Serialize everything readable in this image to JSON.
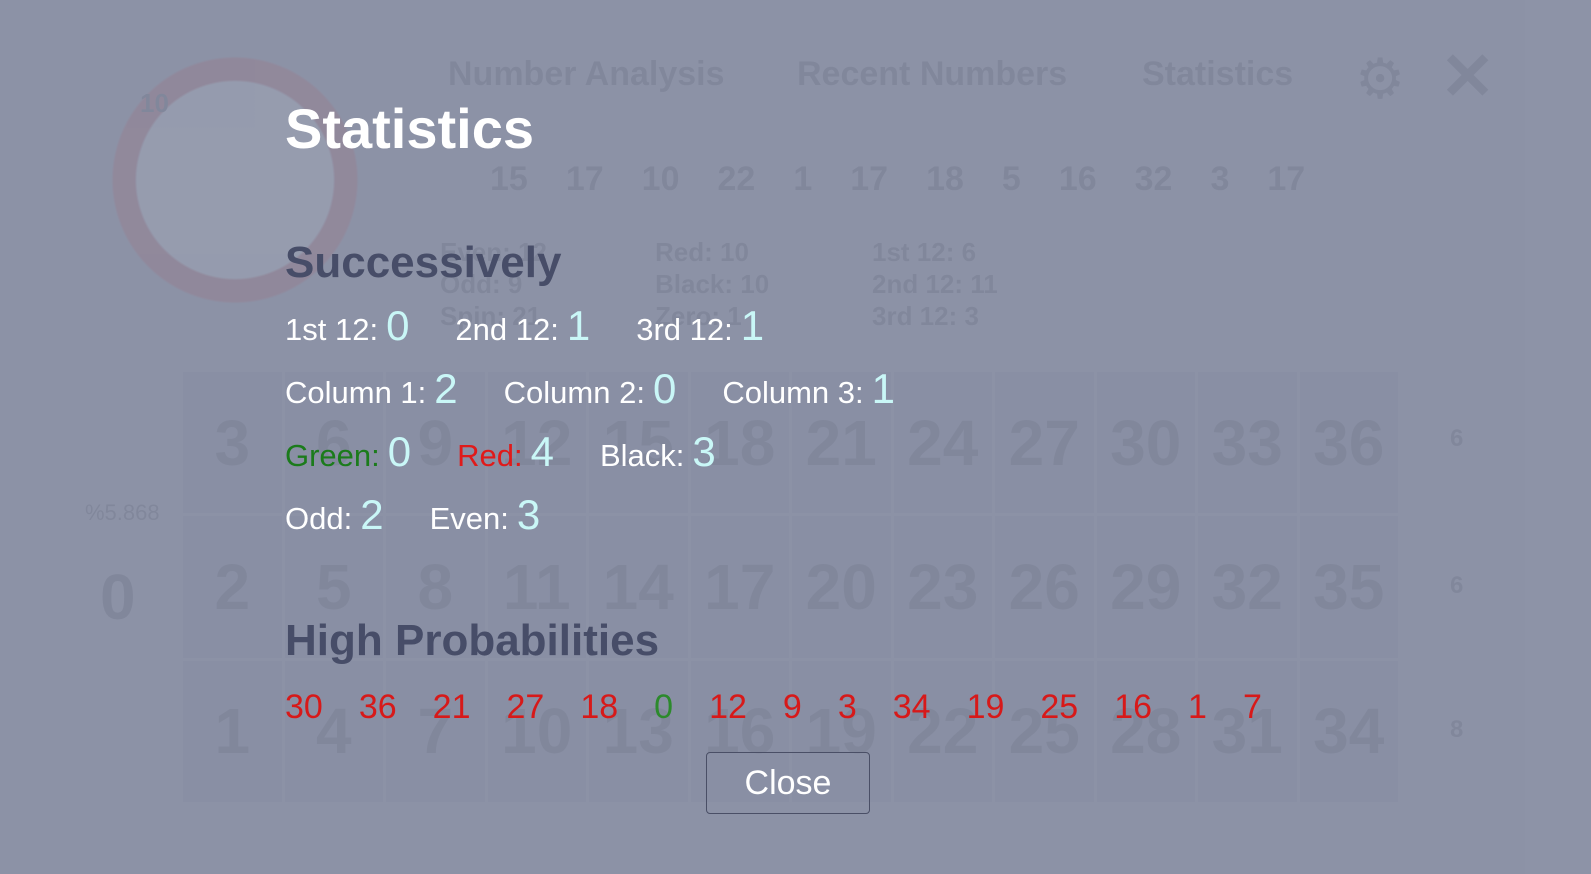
{
  "background": {
    "menu": [
      "Number Analysis",
      "Recent Numbers",
      "Statistics"
    ],
    "wheel_center": "10",
    "recent_numbers": [
      "15",
      "17",
      "10",
      "22",
      "1",
      "17",
      "18",
      "5",
      "16",
      "32",
      "3",
      "17"
    ],
    "summary_col1": [
      "Even: 12",
      "Odd: 9",
      "Spin: 21"
    ],
    "summary_col2": [
      "Red: 10",
      "Black: 10",
      "Zero: 1"
    ],
    "summary_col3": [
      "1st 12: 6",
      "2nd 12: 11",
      "3rd 12: 3"
    ],
    "grid_numbers": [
      "3",
      "6",
      "9",
      "12",
      "15",
      "18",
      "21",
      "24",
      "27",
      "30",
      "33",
      "36",
      "2",
      "5",
      "8",
      "11",
      "14",
      "17",
      "20",
      "23",
      "26",
      "29",
      "32",
      "35",
      "1",
      "4",
      "7",
      "10",
      "13",
      "16",
      "19",
      "22",
      "25",
      "28",
      "31",
      "34"
    ],
    "zero": "0",
    "zero_pct": "%5.868",
    "col_counts": [
      "6",
      "6",
      "8"
    ]
  },
  "modal": {
    "title": "Statistics",
    "successively_title": "Successively",
    "dozens": [
      {
        "label": "1st 12:",
        "value": "0"
      },
      {
        "label": "2nd 12:",
        "value": "1"
      },
      {
        "label": "3rd 12:",
        "value": "1"
      }
    ],
    "columns": [
      {
        "label": "Column 1:",
        "value": "2"
      },
      {
        "label": "Column 2:",
        "value": "0"
      },
      {
        "label": "Column 3:",
        "value": "1"
      }
    ],
    "colors": [
      {
        "label": "Green:",
        "value": "0"
      },
      {
        "label": "Red:",
        "value": "4"
      },
      {
        "label": "Black:",
        "value": "3"
      }
    ],
    "parity": [
      {
        "label": "Odd:",
        "value": "2"
      },
      {
        "label": "Even:",
        "value": "3"
      }
    ],
    "high_prob_title": "High Probabilities",
    "high_probabilities": [
      {
        "n": "30",
        "color": "#d71919"
      },
      {
        "n": "36",
        "color": "#d71919"
      },
      {
        "n": "21",
        "color": "#d71919"
      },
      {
        "n": "27",
        "color": "#d71919"
      },
      {
        "n": "18",
        "color": "#d71919"
      },
      {
        "n": "0",
        "color": "#2c8a2c"
      },
      {
        "n": "12",
        "color": "#d71919"
      },
      {
        "n": "9",
        "color": "#d71919"
      },
      {
        "n": "3",
        "color": "#d71919"
      },
      {
        "n": "34",
        "color": "#d71919"
      },
      {
        "n": "19",
        "color": "#d71919"
      },
      {
        "n": "25",
        "color": "#d71919"
      },
      {
        "n": "16",
        "color": "#d71919"
      },
      {
        "n": "1",
        "color": "#d71919"
      },
      {
        "n": "7",
        "color": "#d71919"
      }
    ],
    "close_label": "Close"
  },
  "colors": {
    "background": "#8d93a7",
    "value_cyan": "#c9f7f7",
    "section_title": "#474d68",
    "red": "#d71919",
    "green": "#2c8a2c"
  }
}
